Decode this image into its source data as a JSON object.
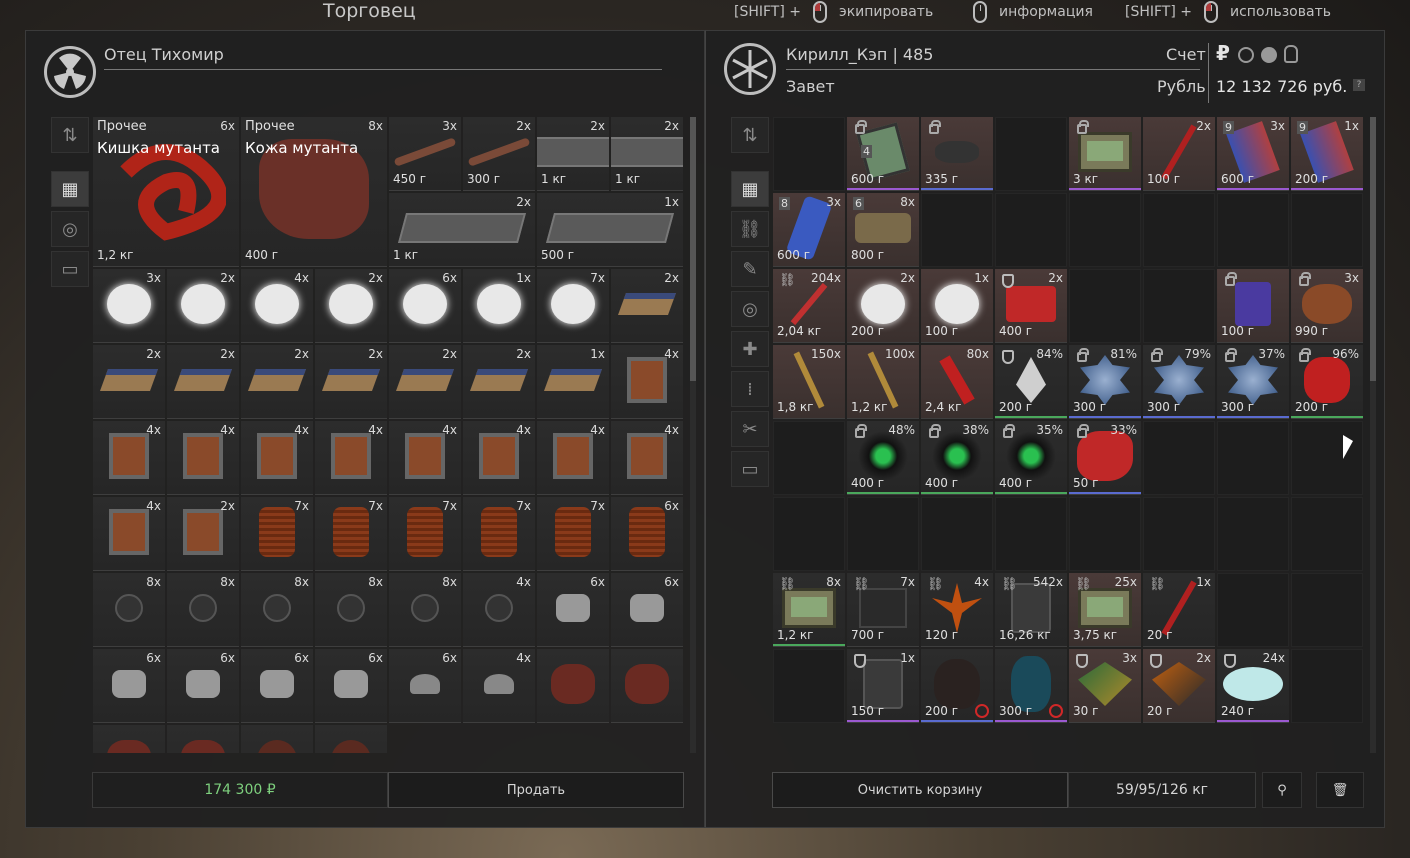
{
  "header": {
    "trader_title": "Торговец",
    "hints": [
      {
        "prefix": "[SHIFT] +",
        "label": "экипировать"
      },
      {
        "prefix": "",
        "label": "информация"
      },
      {
        "prefix": "[SHIFT] +",
        "label": "использовать"
      }
    ]
  },
  "trader": {
    "name": "Отец Тихомир",
    "price_total": "174 300 ₽",
    "sell_label": "Продать",
    "items": [
      {
        "cat": "Прочее",
        "name": "Кишка мутанта",
        "count": "6x",
        "weight": "1,2 кг",
        "big": true,
        "kind": "gut"
      },
      {
        "cat": "Прочее",
        "name": "Кожа мутанта",
        "count": "8x",
        "weight": "400 г",
        "big": true,
        "kind": "skin"
      },
      {
        "count": "3x",
        "weight": "450 г",
        "kind": "bone"
      },
      {
        "count": "2x",
        "weight": "300 г",
        "kind": "bone"
      },
      {
        "count": "2x",
        "weight": "1 кг",
        "kind": "plate"
      },
      {
        "count": "2x",
        "weight": "1 кг",
        "kind": "plate"
      },
      {
        "count": "2x",
        "weight": "1 кг",
        "kind": "plate",
        "span2": true
      },
      {
        "count": "1x",
        "weight": "500 г",
        "kind": "plate",
        "span2": true
      },
      {
        "count": "3x",
        "weight": "",
        "kind": "cotton"
      },
      {
        "count": "2x",
        "weight": "",
        "kind": "cotton"
      },
      {
        "count": "4x",
        "weight": "",
        "kind": "cotton"
      },
      {
        "count": "2x",
        "weight": "",
        "kind": "cotton"
      },
      {
        "count": "6x",
        "weight": "",
        "kind": "cotton"
      },
      {
        "count": "1x",
        "weight": "",
        "kind": "cotton"
      },
      {
        "count": "7x",
        "weight": "",
        "kind": "cotton"
      },
      {
        "count": "2x",
        "weight": "",
        "kind": "panel"
      },
      {
        "count": "2x",
        "weight": "",
        "kind": "panel"
      },
      {
        "count": "2x",
        "weight": "",
        "kind": "panel"
      },
      {
        "count": "2x",
        "weight": "",
        "kind": "panel"
      },
      {
        "count": "2x",
        "weight": "",
        "kind": "panel"
      },
      {
        "count": "2x",
        "weight": "",
        "kind": "panel"
      },
      {
        "count": "2x",
        "weight": "",
        "kind": "panel"
      },
      {
        "count": "1x",
        "weight": "",
        "kind": "panel"
      },
      {
        "count": "4x",
        "weight": "",
        "kind": "transformer"
      },
      {
        "count": "4x",
        "weight": "",
        "kind": "transformer"
      },
      {
        "count": "4x",
        "weight": "",
        "kind": "transformer"
      },
      {
        "count": "4x",
        "weight": "",
        "kind": "transformer"
      },
      {
        "count": "4x",
        "weight": "",
        "kind": "transformer"
      },
      {
        "count": "4x",
        "weight": "",
        "kind": "transformer"
      },
      {
        "count": "4x",
        "weight": "",
        "kind": "transformer"
      },
      {
        "count": "4x",
        "weight": "",
        "kind": "transformer"
      },
      {
        "count": "4x",
        "weight": "",
        "kind": "transformer"
      },
      {
        "count": "4x",
        "weight": "",
        "kind": "transformer"
      },
      {
        "count": "2x",
        "weight": "",
        "kind": "transformer"
      },
      {
        "count": "7x",
        "weight": "",
        "kind": "coil"
      },
      {
        "count": "7x",
        "weight": "",
        "kind": "coil"
      },
      {
        "count": "7x",
        "weight": "",
        "kind": "coil"
      },
      {
        "count": "7x",
        "weight": "",
        "kind": "coil"
      },
      {
        "count": "7x",
        "weight": "",
        "kind": "coil"
      },
      {
        "count": "6x",
        "weight": "",
        "kind": "coil"
      },
      {
        "count": "8x",
        "weight": "",
        "kind": "cap"
      },
      {
        "count": "8x",
        "weight": "",
        "kind": "cap"
      },
      {
        "count": "8x",
        "weight": "",
        "kind": "cap"
      },
      {
        "count": "8x",
        "weight": "",
        "kind": "cap"
      },
      {
        "count": "8x",
        "weight": "",
        "kind": "cap"
      },
      {
        "count": "4x",
        "weight": "",
        "kind": "cap"
      },
      {
        "count": "6x",
        "weight": "",
        "kind": "crystal"
      },
      {
        "count": "6x",
        "weight": "",
        "kind": "crystal"
      },
      {
        "count": "6x",
        "weight": "",
        "kind": "crystal"
      },
      {
        "count": "6x",
        "weight": "",
        "kind": "crystal"
      },
      {
        "count": "6x",
        "weight": "",
        "kind": "crystal"
      },
      {
        "count": "6x",
        "weight": "",
        "kind": "crystal"
      },
      {
        "count": "6x",
        "weight": "",
        "kind": "transistor"
      },
      {
        "count": "4x",
        "weight": "",
        "kind": "transistor"
      },
      {
        "count": "",
        "weight": "",
        "kind": "heart"
      },
      {
        "count": "",
        "weight": "",
        "kind": "heart"
      },
      {
        "count": "",
        "weight": "",
        "kind": "heart"
      },
      {
        "count": "",
        "weight": "",
        "kind": "heart"
      },
      {
        "count": "",
        "weight": "",
        "kind": "ball"
      },
      {
        "count": "",
        "weight": "",
        "kind": "ball"
      }
    ]
  },
  "player": {
    "name": "Кирилл_Кэп | 485",
    "faction": "Завет",
    "account_label": "Счет",
    "currency_label": "Рубль",
    "money": "12 132 726 руб.",
    "currency_symbol": "₽",
    "help": "?",
    "clear_label": "Очистить корзину",
    "weight": "59/95/126 кг",
    "items": [
      {
        "empty": true
      },
      {
        "count": "",
        "weight": "600 г",
        "kind": "device",
        "lock": true,
        "level": "4",
        "tint": true,
        "q": "purple"
      },
      {
        "count": "",
        "weight": "335 г",
        "kind": "rocks",
        "lock": true,
        "tint": true,
        "q": "blue"
      },
      {
        "empty": true
      },
      {
        "count": "",
        "weight": "3 кг",
        "kind": "pda",
        "lock": true,
        "tint": true,
        "q": "purple"
      },
      {
        "count": "2x",
        "weight": "100 г",
        "kind": "stick",
        "tint": true
      },
      {
        "count": "3x",
        "weight": "600 г",
        "kind": "can",
        "level": "9",
        "tint": true,
        "q": "purple"
      },
      {
        "count": "1x",
        "weight": "200 г",
        "kind": "can",
        "level": "9",
        "tint": true,
        "q": "purple"
      },
      {
        "count": "3x",
        "weight": "600 г",
        "kind": "bottle",
        "level": "8",
        "tint": true
      },
      {
        "count": "8x",
        "weight": "800 г",
        "kind": "bar",
        "level": "6",
        "tint": true
      },
      {
        "empty": true
      },
      {
        "empty": true
      },
      {
        "empty": true
      },
      {
        "empty": true
      },
      {
        "empty": true
      },
      {
        "empty": true
      },
      {
        "count": "204x",
        "weight": "2,04 кг",
        "kind": "tube",
        "link": true,
        "tint": true
      },
      {
        "count": "2x",
        "weight": "200 г",
        "kind": "cotton",
        "tint": true
      },
      {
        "count": "1x",
        "weight": "100 г",
        "kind": "cotton",
        "tint": true
      },
      {
        "count": "2x",
        "weight": "400 г",
        "kind": "case",
        "shield": true,
        "tint": true
      },
      {
        "empty": true
      },
      {
        "empty": true
      },
      {
        "count": "",
        "weight": "100 г",
        "kind": "battery",
        "lock": true,
        "tint": true
      },
      {
        "count": "3x",
        "weight": "990 г",
        "kind": "stone",
        "lock": true,
        "tint": true
      },
      {
        "count": "150x",
        "weight": "1,8 кг",
        "kind": "ammo",
        "tint": true
      },
      {
        "count": "100x",
        "weight": "1,2 кг",
        "kind": "ammo",
        "tint": true
      },
      {
        "count": "80x",
        "weight": "2,4 кг",
        "kind": "shell",
        "tint": true
      },
      {
        "count": "84%",
        "weight": "200 г",
        "kind": "arte",
        "shield": true,
        "q": "green"
      },
      {
        "count": "81%",
        "weight": "300 г",
        "kind": "orb",
        "lock": true,
        "q": "blue"
      },
      {
        "count": "79%",
        "weight": "300 г",
        "kind": "orb",
        "lock": true,
        "q": "blue"
      },
      {
        "count": "37%",
        "weight": "300 г",
        "kind": "orb",
        "lock": true,
        "q": "blue"
      },
      {
        "count": "96%",
        "weight": "200 г",
        "kind": "redarte",
        "lock": true,
        "q": "green"
      },
      {
        "empty": true
      },
      {
        "count": "48%",
        "weight": "400 г",
        "kind": "urchin",
        "lock": true,
        "q": "green"
      },
      {
        "count": "38%",
        "weight": "400 г",
        "kind": "urchin",
        "lock": true,
        "q": "green"
      },
      {
        "count": "35%",
        "weight": "400 г",
        "kind": "urchin",
        "lock": true,
        "q": "green"
      },
      {
        "count": "33%",
        "weight": "50 г",
        "kind": "coral",
        "lock": true,
        "q": "blue"
      },
      {
        "empty": true
      },
      {
        "empty": true
      },
      {
        "empty": true
      },
      {
        "empty": true
      },
      {
        "empty": true
      },
      {
        "empty": true
      },
      {
        "empty": true
      },
      {
        "empty": true
      },
      {
        "empty": true
      },
      {
        "empty": true
      },
      {
        "empty": true
      },
      {
        "count": "8x",
        "weight": "1,2 кг",
        "kind": "pda",
        "link": true,
        "q": "green"
      },
      {
        "count": "7x",
        "weight": "700 г",
        "kind": "box",
        "link": true
      },
      {
        "count": "4x",
        "weight": "120 г",
        "kind": "fern",
        "link": true
      },
      {
        "count": "542x",
        "weight": "16,26 кг",
        "kind": "mech",
        "link": true
      },
      {
        "count": "25x",
        "weight": "3,75 кг",
        "kind": "pda",
        "link": true,
        "tint": true
      },
      {
        "count": "1x",
        "weight": "20 г",
        "kind": "stick",
        "link": true
      },
      {
        "empty": true
      },
      {
        "empty": true
      },
      {
        "empty": true
      },
      {
        "count": "1x",
        "weight": "150 г",
        "kind": "mech",
        "shield": true,
        "q": "purple"
      },
      {
        "count": "",
        "weight": "200 г",
        "kind": "rock",
        "timer": true,
        "q": "blue"
      },
      {
        "count": "",
        "weight": "300 г",
        "kind": "cocoon",
        "timer": true,
        "q": "purple"
      },
      {
        "count": "3x",
        "weight": "30 г",
        "kind": "chip",
        "shield": true,
        "tint": true
      },
      {
        "count": "2x",
        "weight": "20 г",
        "kind": "chip2",
        "shield": true,
        "tint": true
      },
      {
        "count": "24x",
        "weight": "240 г",
        "kind": "salt",
        "shield": true,
        "q": "purple"
      },
      {
        "empty": true
      }
    ]
  }
}
